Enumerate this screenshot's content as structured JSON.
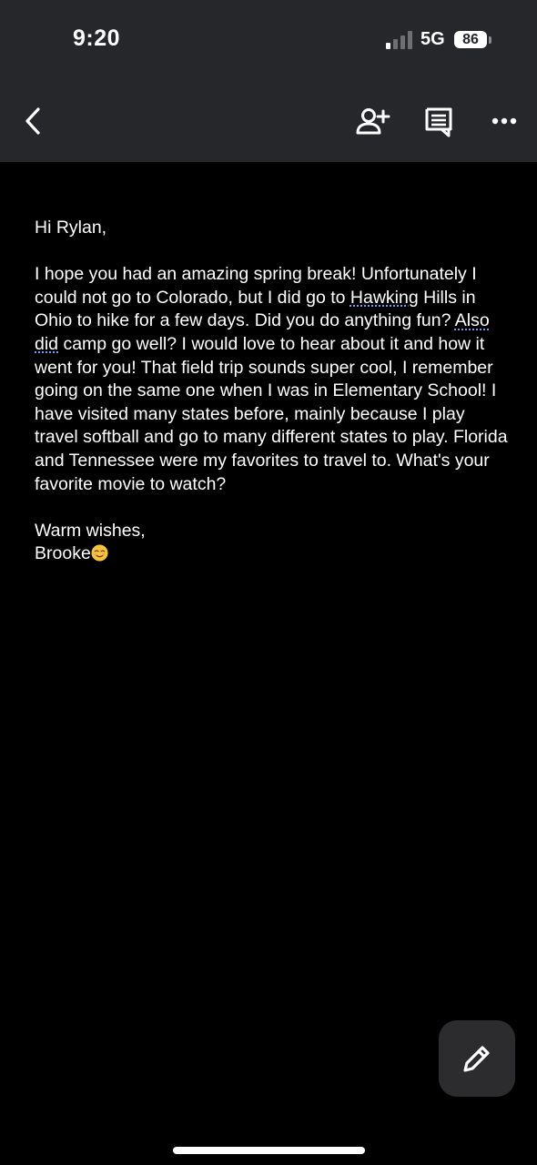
{
  "status_bar": {
    "time": "9:20",
    "network": "5G",
    "battery": "86",
    "signal_bars_active": 1,
    "signal_bars_total": 4
  },
  "toolbar": {
    "back_icon": "chevron-left-icon",
    "share_icon": "add-person-icon",
    "comment_icon": "comment-icon",
    "more_icon": "more-horizontal-icon"
  },
  "letter": {
    "greeting": "Hi Rylan,",
    "body_segments": [
      "I hope you had an amazing spring break! Unfortunately I could not go to Colorado, but I did go to ",
      "Hawking",
      " Hills in Ohio to hike for a few days. Did you do anything fun? ",
      "Also did",
      " camp go well? I would love to hear about it and how it went for you! That field trip sounds super cool, I remember going on the same one when I was in Elementary School! I have visited many states before, mainly because I play travel softball and go to many different states to play. Florida and Tennessee were my favorites to travel to. What's your favorite movie to watch?"
    ],
    "closing": "Warm wishes,",
    "signature": "Brooke",
    "signature_emoji": "relieved-face-emoji"
  },
  "fab": {
    "icon": "pencil-icon"
  },
  "colors": {
    "toolbar_bg": "#26272b",
    "page_bg": "#000000",
    "text": "#ffffff",
    "spellcheck_underline": "#6f9cf2",
    "fab_bg": "#2c2c2e"
  }
}
